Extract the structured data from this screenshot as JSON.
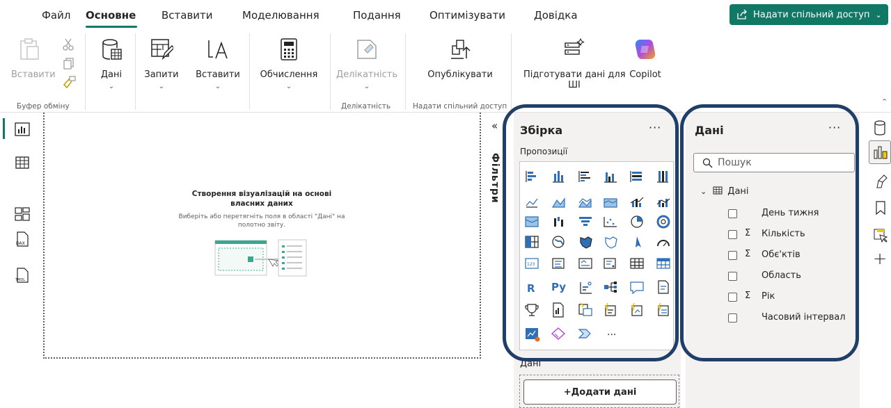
{
  "menu": {
    "file": "Файл",
    "home": "Основне",
    "insert": "Вставити",
    "modeling": "Моделювання",
    "view": "Подання",
    "optimize": "Оптимізувати",
    "help": "Довідка",
    "share": "Надати спільний доступ"
  },
  "ribbon": {
    "paste": "Вставити",
    "data": "Дані",
    "queries": "Запити",
    "insert": "Вставити",
    "calculations": "Обчислення",
    "sensitivity": "Делікатність",
    "publish": "Опублікувати",
    "prepare_line1": "Підготувати дані для",
    "prepare_line2": "ШІ",
    "copilot": "Copilot",
    "group_clipboard": "Буфер обміну",
    "group_sensitivity": "Делікатність",
    "group_share": "Надати спільний доступ"
  },
  "canvas": {
    "empty_title": "Створення візуалізацій на основі власних даних",
    "empty_sub": "Виберіть або перетягніть поля в області \"Дані\" на полотно звіту."
  },
  "filters": {
    "label": "Фільтри"
  },
  "viz_pane": {
    "title": "Збірка",
    "more": "···",
    "suggestions": "Пропозиції",
    "data_section": "Дані",
    "add_data": "+Додати дані",
    "icons": {
      "r": "R",
      "py": "Py",
      "more": "···"
    }
  },
  "data_pane": {
    "title": "Дані",
    "more": "···",
    "search_placeholder": "Пошук",
    "table_name": "Дані",
    "fields": [
      {
        "label": "День тижня",
        "sigma": false
      },
      {
        "label": "Кількість",
        "sigma": true
      },
      {
        "label": "Обє'ктів",
        "sigma": true
      },
      {
        "label": "Область",
        "sigma": false
      },
      {
        "label": "Рік",
        "sigma": true
      },
      {
        "label": "Часовий інтервал",
        "sigma": false
      }
    ]
  },
  "nav": {
    "dax": "DAX",
    "tmdl": "TMDL"
  },
  "colors": {
    "accent": "#117865",
    "outline": "#1f3e68",
    "pane_bg": "#f3f2f1",
    "viz_blue": "#2f6fb5",
    "viz_yellow": "#f2c811"
  }
}
